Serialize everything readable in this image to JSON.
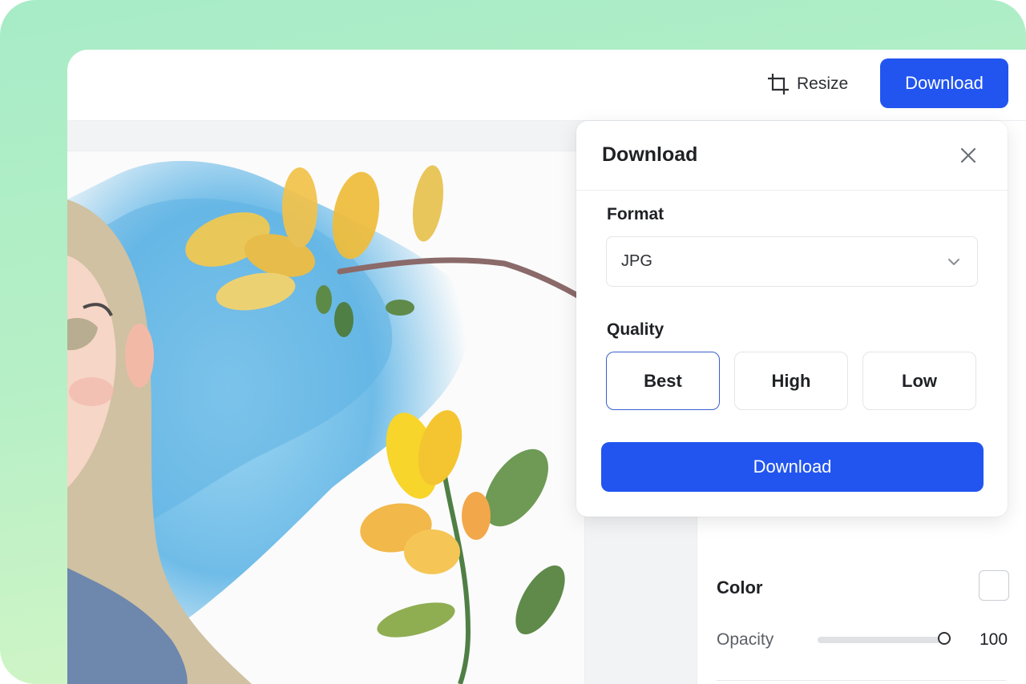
{
  "toolbar": {
    "resize_label": "Resize",
    "download_label": "Download"
  },
  "side_panel": {
    "color_label": "Color",
    "color_value": "#ffffff",
    "opacity_label": "Opacity",
    "opacity_value": "100",
    "opacity_level": 1.0
  },
  "download_dialog": {
    "title": "Download",
    "format_label": "Format",
    "format_value": "JPG",
    "quality_label": "Quality",
    "quality_options": [
      "Best",
      "High",
      "Low"
    ],
    "quality_selected": "Best",
    "download_label": "Download"
  },
  "icons": {
    "resize": "crop-icon",
    "close": "close-icon",
    "dropdown": "chevron-down-icon"
  },
  "colors": {
    "accent": "#2255ef",
    "frame_green": "#a7ecc7",
    "selected_border": "#3a5fcf"
  }
}
